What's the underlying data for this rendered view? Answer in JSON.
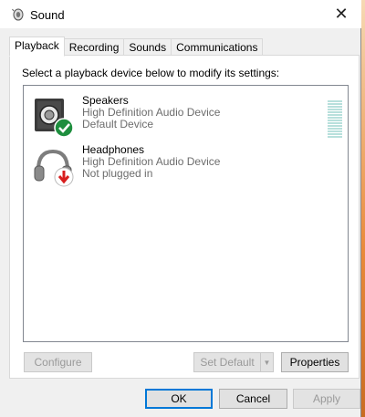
{
  "window": {
    "title": "Sound",
    "close_glyph": "✕"
  },
  "tabs": [
    {
      "label": "Playback",
      "active": true
    },
    {
      "label": "Recording",
      "active": false
    },
    {
      "label": "Sounds",
      "active": false
    },
    {
      "label": "Communications",
      "active": false
    }
  ],
  "panel": {
    "instruction": "Select a playback device below to modify its settings:"
  },
  "devices": [
    {
      "name": "Speakers",
      "driver": "High Definition Audio Device",
      "status": "Default Device",
      "icon": "speaker-icon",
      "badge": "check-badge-icon",
      "badge_color": "#1e8e3e"
    },
    {
      "name": "Headphones",
      "driver": "High Definition Audio Device",
      "status": "Not plugged in",
      "icon": "headphones-icon",
      "badge": "down-arrow-badge-icon",
      "badge_color": "#d81e1e"
    }
  ],
  "buttons": {
    "configure": "Configure",
    "set_default": "Set Default",
    "properties": "Properties",
    "ok": "OK",
    "cancel": "Cancel",
    "apply": "Apply"
  },
  "colors": {
    "accent": "#0078d7",
    "meter": "#b8e0dc"
  }
}
